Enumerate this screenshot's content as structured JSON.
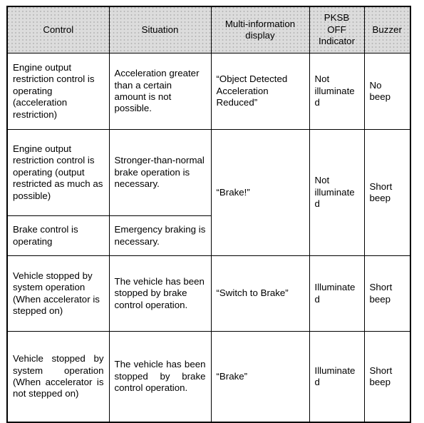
{
  "table": {
    "name": "pksb-control-status-table",
    "headers": [
      {
        "id": "control",
        "label": "Control"
      },
      {
        "id": "situation",
        "label": "Situation"
      },
      {
        "id": "display",
        "label": "Multi-information display"
      },
      {
        "id": "pksb",
        "label": "PKSB OFF Indicator"
      },
      {
        "id": "buzzer",
        "label": "Buzzer"
      }
    ],
    "header_lines": {
      "display": [
        "Multi-information",
        "display"
      ],
      "pksb": [
        "PKSB",
        "OFF",
        "Indicator"
      ]
    },
    "rows": [
      {
        "control": "Engine output restriction control is operating (acceleration restriction)",
        "situation": "Acceleration greater than a certain amount is not possible.",
        "display": "“Object Detected Acceleration Reduced”",
        "pksb": "Not illuminated",
        "buzzer": "No beep"
      },
      {
        "control": "Engine output restriction control is operating (output restricted as much as possible)",
        "situation": "Stronger-than-normal brake operation is necessary.",
        "display": "“Brake!”",
        "pksb": "Not illuminated",
        "buzzer": "Short beep"
      },
      {
        "control": "Brake control is operating",
        "situation": "Emergency braking is necessary.",
        "display": "",
        "pksb": "",
        "buzzer": ""
      },
      {
        "control": "Vehicle stopped by system operation (When accelerator is stepped on)",
        "situation": "The vehicle has been stopped by brake control operation.",
        "display": "“Switch to Brake”",
        "pksb": "Illuminated",
        "buzzer": "Short beep"
      },
      {
        "control": "Vehicle stopped by system operation (When accelerator is not stepped on)",
        "situation": "The vehicle has been stopped by brake control operation.",
        "display": "“Brake”",
        "pksb": "Illuminated",
        "buzzer": "Short beep"
      }
    ],
    "colors": {
      "header_background": "#dcdcdc",
      "border": "#000000",
      "text": "#000000",
      "cell_background": "#ffffff"
    }
  }
}
